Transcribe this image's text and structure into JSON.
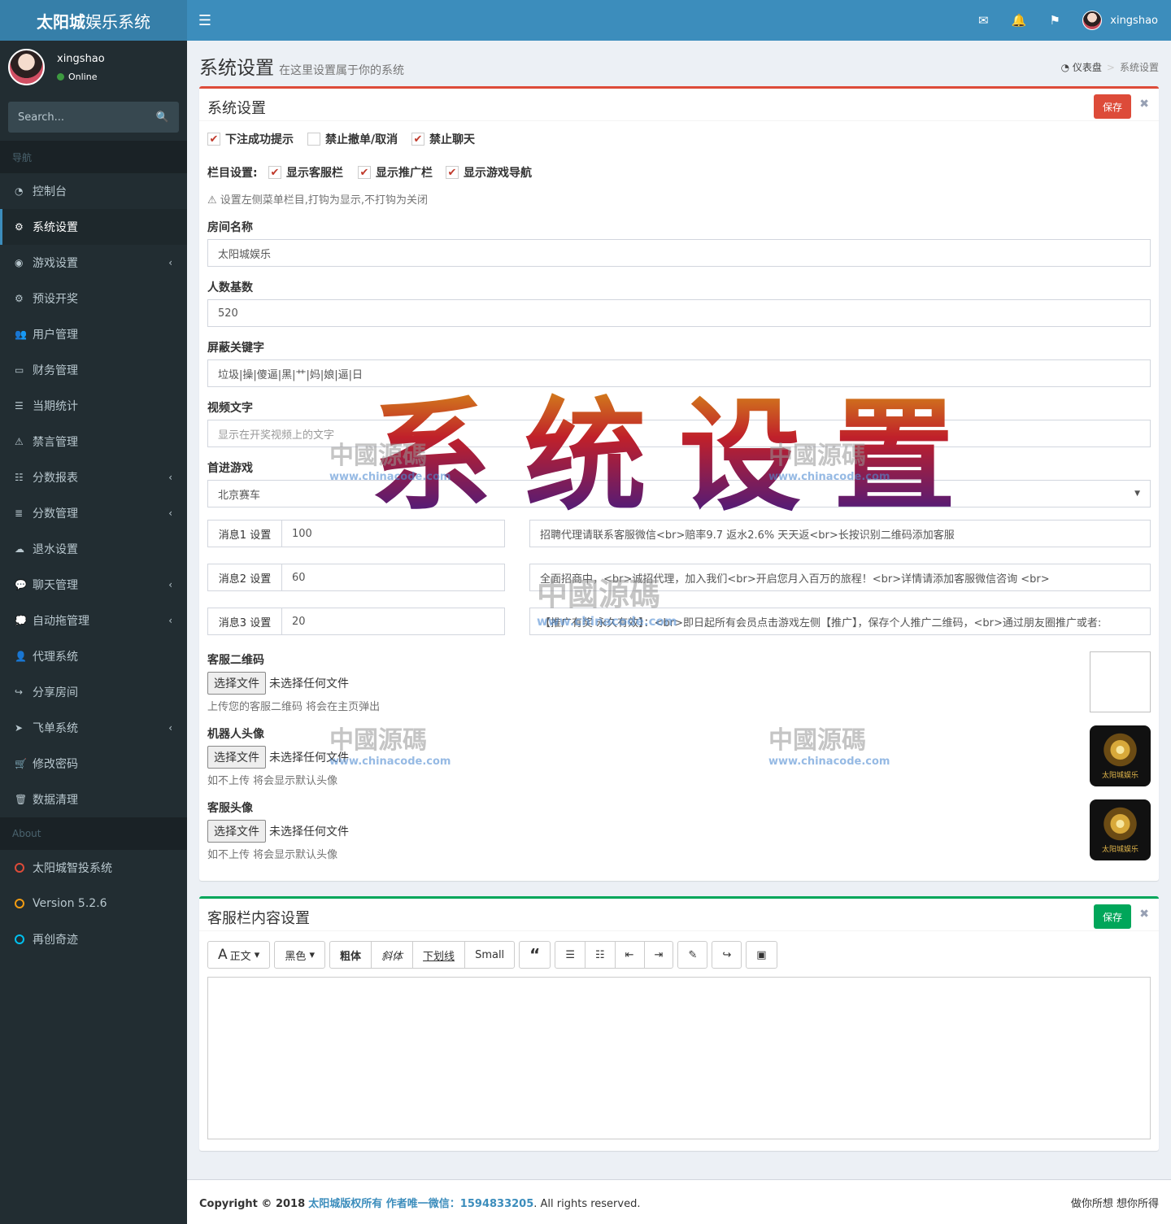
{
  "header": {
    "logo_bold": "太阳城",
    "logo_rest": "娱乐系统",
    "username": "xingshao"
  },
  "sidebar": {
    "username": "xingshao",
    "status": "Online",
    "search_placeholder": "Search...",
    "nav_header": "导航",
    "items": [
      {
        "label": "控制台",
        "icon": "dashboard-icon",
        "arrow": false
      },
      {
        "label": "系统设置",
        "icon": "cogs-icon",
        "arrow": false,
        "active": true
      },
      {
        "label": "游戏设置",
        "icon": "gamepad-icon",
        "arrow": true
      },
      {
        "label": "预设开奖",
        "icon": "gear-icon",
        "arrow": false
      },
      {
        "label": "用户管理",
        "icon": "users-icon",
        "arrow": false
      },
      {
        "label": "财务管理",
        "icon": "money-icon",
        "arrow": false
      },
      {
        "label": "当期统计",
        "icon": "list-icon",
        "arrow": false
      },
      {
        "label": "禁言管理",
        "icon": "warning-icon",
        "arrow": false
      },
      {
        "label": "分数报表",
        "icon": "list-ol-icon",
        "arrow": true
      },
      {
        "label": "分数管理",
        "icon": "database-icon",
        "arrow": true
      },
      {
        "label": "退水设置",
        "icon": "cloud-download-icon",
        "arrow": false
      },
      {
        "label": "聊天管理",
        "icon": "comments-icon",
        "arrow": true
      },
      {
        "label": "自动拖管理",
        "icon": "comment-dots-icon",
        "arrow": true
      },
      {
        "label": "代理系统",
        "icon": "user-plus-icon",
        "arrow": false
      },
      {
        "label": "分享房间",
        "icon": "share-icon",
        "arrow": false
      },
      {
        "label": "飞单系统",
        "icon": "paper-plane-icon",
        "arrow": true
      },
      {
        "label": "修改密码",
        "icon": "cart-icon",
        "arrow": false
      },
      {
        "label": "数据清理",
        "icon": "trash-icon",
        "arrow": false
      }
    ],
    "about_header": "About",
    "about_items": [
      {
        "label": "太阳城智投系统",
        "color": "#dd4b39"
      },
      {
        "label": "Version 5.2.6",
        "color": "#f39c12"
      },
      {
        "label": "再创奇迹",
        "color": "#00c0ef"
      }
    ]
  },
  "page": {
    "title": "系统设置",
    "subtitle": "在这里设置属于你的系统",
    "breadcrumb_home": "仪表盘",
    "breadcrumb_current": "系统设置"
  },
  "settings": {
    "box_title": "系统设置",
    "save_label": "保存",
    "accent": "#dd4b39",
    "check1": {
      "label": "下注成功提示",
      "checked": true
    },
    "check2": {
      "label": "禁止撤单/取消",
      "checked": false
    },
    "check3": {
      "label": "禁止聊天",
      "checked": true
    },
    "column_label": "栏目设置:",
    "col1": {
      "label": "显示客服栏",
      "checked": true
    },
    "col2": {
      "label": "显示推广栏",
      "checked": true
    },
    "col3": {
      "label": "显示游戏导航",
      "checked": true
    },
    "column_help": "设置左侧菜单栏目,打钩为显示,不打钩为关闭",
    "room_name_label": "房间名称",
    "room_name_value": "太阳城娱乐",
    "base_count_label": "人数基数",
    "base_count_value": "520",
    "keywords_label": "屏蔽关键字",
    "keywords_value": "垃圾|操|傻逼|黑|艹|妈|娘|逼|日",
    "video_label": "视频文字",
    "video_placeholder": "显示在开奖视频上的文字",
    "first_game_label": "首进游戏",
    "first_game_value": "北京赛车",
    "msg1_label": "消息1 设置",
    "msg1_value": "100",
    "msg1_text": "招聘代理请联系客服微信<br>赔率9.7 返水2.6% 天天返<br>长按识别二维码添加客服",
    "msg2_label": "消息2 设置",
    "msg2_value": "60",
    "msg2_text": "全面招商中，<br>诚招代理，加入我们<br>开启您月入百万的旅程！<br>详情请添加客服微信咨询 <br>",
    "msg3_label": "消息3 设置",
    "msg3_value": "20",
    "msg3_text": "【推广有奖 永久有效】：<br>即日起所有会员点击游戏左侧【推广】，保存个人推广二维码，<br>通过朋友圈推广或者:",
    "qr_label": "客服二维码",
    "choose_file": "选择文件",
    "no_file": "未选择任何文件",
    "qr_help": "上传您的客服二维码 将会在主页弹出",
    "robot_label": "机器人头像",
    "robot_help": "如不上传 将会显示默认头像",
    "service_label": "客服头像",
    "service_help": "如不上传 将会显示默认头像",
    "logo_caption": "太阳城娱乐"
  },
  "service_box": {
    "title": "客服栏内容设置",
    "save_label": "保存",
    "accent": "#00a65a",
    "toolbar": {
      "font": "正文",
      "color": "黑色",
      "bold": "粗体",
      "italic": "斜体",
      "underline": "下划线",
      "small": "Small"
    }
  },
  "overlay": {
    "big_text": "系统设置",
    "watermark": "中國源碼",
    "watermark_url": "www.chinacode.com"
  },
  "footer": {
    "copyright": "Copyright © 2018",
    "owner": "太阳城版权所有 作者唯一微信：1594833205",
    "rights": ". All rights reserved.",
    "slogan": "做你所想 想你所得"
  }
}
